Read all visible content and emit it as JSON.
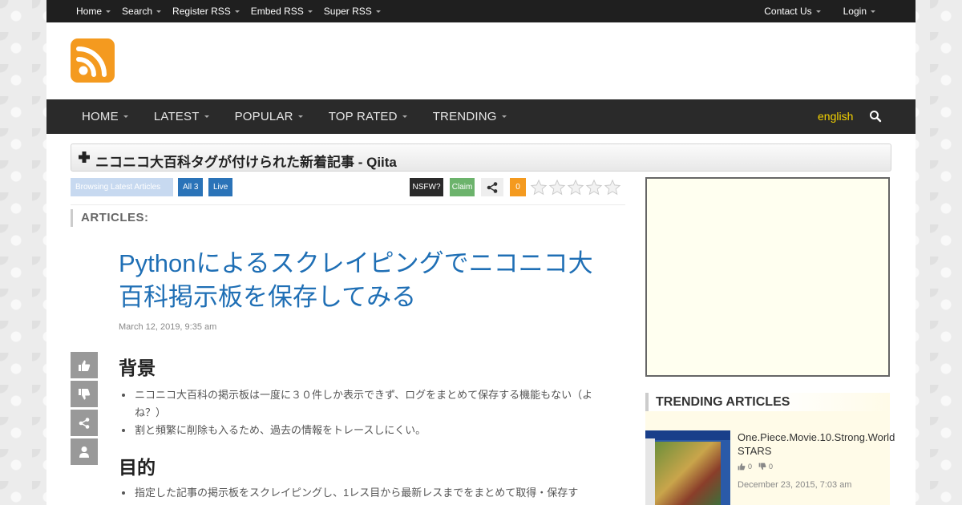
{
  "topbar": {
    "left": [
      "Home",
      "Search",
      "Register RSS",
      "Embed RSS",
      "Super RSS"
    ],
    "right": [
      "Contact Us",
      "Login"
    ]
  },
  "mainnav": {
    "items": [
      "HOME",
      "LATEST",
      "POPULAR",
      "TOP RATED",
      "TRENDING"
    ],
    "language": "english"
  },
  "feed": {
    "title": "ニコニコ大百科タグが付けられた新着記事 - Qiita",
    "badges": {
      "browse": "Browsing Latest Articles",
      "all": "All 3",
      "live": "Live",
      "nsfw": "NSFW?",
      "claim": "Claim",
      "count": "0"
    },
    "rating": 0,
    "articles_label": "ARTICLES:"
  },
  "article": {
    "title": "Pythonによるスクレイピングでニコニコ大百科掲示板を保存してみる",
    "date": "March 12, 2019, 9:35 am",
    "sections": [
      {
        "heading": "背景",
        "items": [
          "ニコニコ大百科の掲示板は一度に３０件しか表示できず、ログをまとめて保存する機能もない（よね？）",
          "割と頻繁に削除も入るため、過去の情報をトレースしにくい。"
        ]
      },
      {
        "heading": "目的",
        "items": [
          "指定した記事の掲示板をスクレイピングし、1レス目から最新レスまでをまとめて取得・保存す"
        ]
      }
    ]
  },
  "sidebar": {
    "trending_heading": "TRENDING ARTICLES",
    "trending": [
      {
        "title": "One.Piece.Movie.10.Strong.World",
        "title_line2": "STARS",
        "likes": "0",
        "dislikes": "0",
        "date": "December 23, 2015, 7:03 am"
      }
    ]
  },
  "colors": {
    "accent": "#f49a1f",
    "link": "#1f6fb5",
    "nav_bg": "#2a2a2a",
    "topbar_bg": "#1f1f1f",
    "badge_blue": "#2a73b8",
    "claim_green": "#6cb36c",
    "lang_yellow": "#f5d300"
  },
  "icons": {
    "logo": "rss-icon",
    "nav_search": "search-icon",
    "title_plus": "plus-icon",
    "share": "share-icon",
    "like": "thumbs-up-icon",
    "dislike": "thumbs-down-icon",
    "author": "user-icon"
  }
}
